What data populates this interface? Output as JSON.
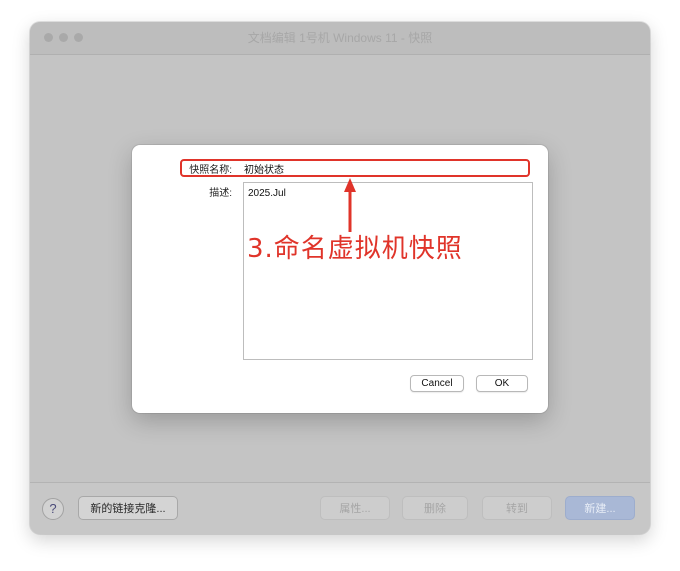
{
  "window": {
    "title": "文档编辑 1号机 Windows 11 - 快照"
  },
  "dialog": {
    "name_label": "快照名称:",
    "name_value": "初始状态",
    "desc_label": "描述:",
    "desc_value": "2025.Jul",
    "cancel_label": "Cancel",
    "ok_label": "OK"
  },
  "annotation": {
    "text": "3.命名虚拟机快照",
    "color": "#e0342a"
  },
  "bottom": {
    "help_label": "?",
    "linked_clone_label": "新的链接克隆...",
    "properties_label": "属性...",
    "delete_label": "删除",
    "goto_label": "转到",
    "new_label": "新建..."
  }
}
